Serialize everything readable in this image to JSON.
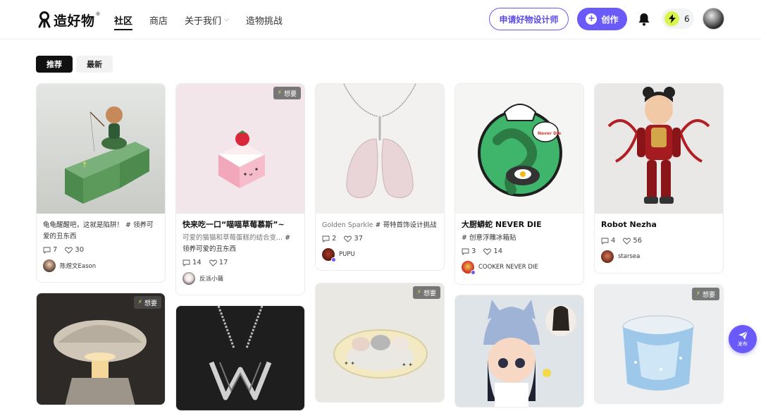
{
  "header": {
    "logo_text": "造好物",
    "logo_sup": "®",
    "nav": [
      {
        "label": "社区",
        "active": true
      },
      {
        "label": "商店",
        "active": false
      },
      {
        "label": "关于我们",
        "active": false,
        "chevron": true
      },
      {
        "label": "造物挑战",
        "active": false
      }
    ],
    "apply_button": "申请好物设计师",
    "create_button": "创作",
    "energy_count": "6"
  },
  "tabs": [
    {
      "label": "推荐",
      "active": true
    },
    {
      "label": "最新",
      "active": false
    }
  ],
  "want_label": "想要",
  "publish_label": "发布",
  "cards": [
    {
      "title": "",
      "desc": "龟龟醒醒吧，这就是陷阱！ # 领养可爱的丑东西",
      "comments": "7",
      "likes": "30",
      "author": "陈煜文Eason"
    },
    {
      "title": "快来吃一口“喵喵草莓慕斯”~",
      "desc_muted": "可爱的猫猫和草莓蛋糕的结合变...",
      "desc": " # 领养可爱的丑东西",
      "comments": "14",
      "likes": "17",
      "author": "反派小薇",
      "want": true
    },
    {
      "title": "",
      "desc_muted": "Golden Sparkle",
      "desc": " # 哥特首饰设计挑战",
      "comments": "2",
      "likes": "37",
      "author": "PUPU"
    },
    {
      "title": "大厨蟒蛇 NEVER DIE",
      "desc": "# 创意浮雕冰箱贴",
      "comments": "3",
      "likes": "14",
      "author": "COOKER NEVER DIE",
      "image_text": "Never Die"
    },
    {
      "title": "Robot Nezha",
      "desc": "",
      "comments": "4",
      "likes": "56",
      "author": "starsea"
    }
  ],
  "row2": [
    {
      "want": true
    },
    {
      "want": false
    },
    {
      "want": true
    },
    {
      "want": false
    },
    {
      "want": true
    }
  ],
  "colors": {
    "accent": "#6a5af9",
    "energy": "#d9f54a",
    "active_tab": "#111111"
  }
}
